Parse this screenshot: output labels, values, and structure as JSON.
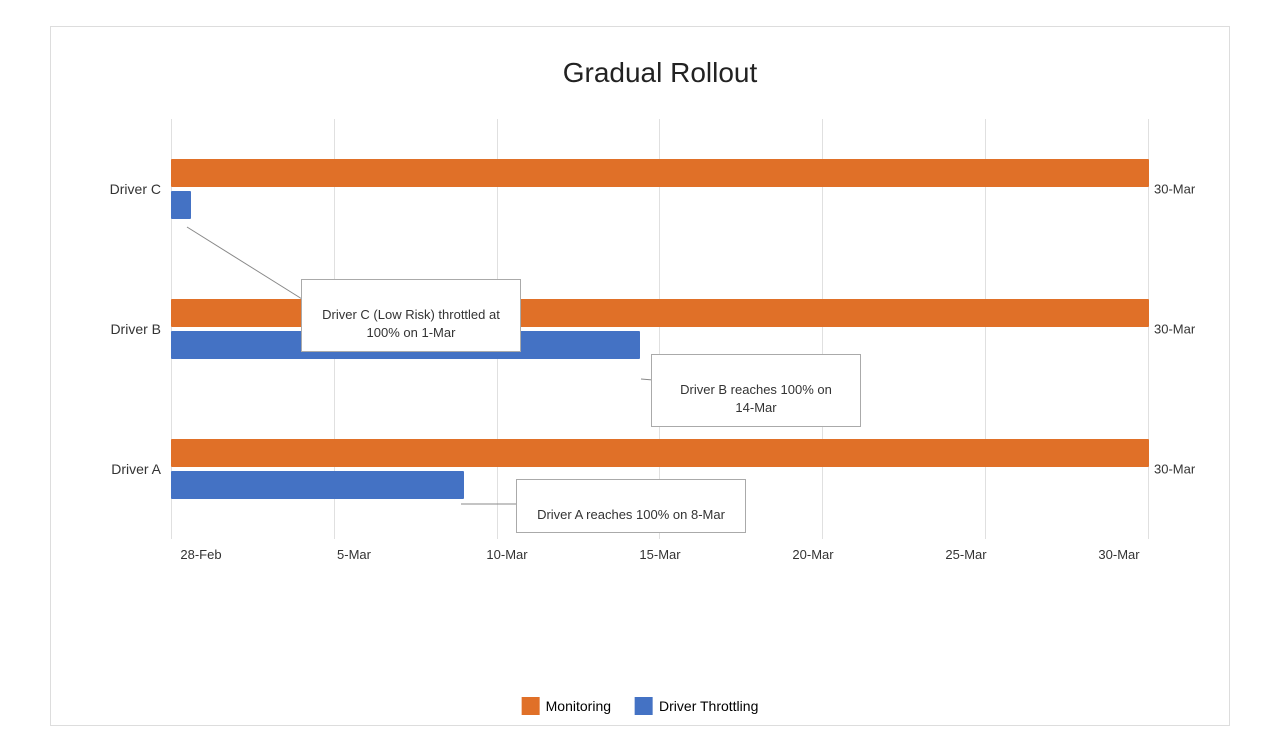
{
  "chart": {
    "title": "Gradual Rollout",
    "yLabels": [
      "Driver C",
      "Driver B",
      "Driver A"
    ],
    "xLabels": [
      "28-Feb",
      "5-Mar",
      "10-Mar",
      "15-Mar",
      "20-Mar",
      "25-Mar",
      "30-Mar"
    ],
    "endLabels": [
      "30-Mar",
      "30-Mar",
      "30-Mar"
    ],
    "legend": {
      "items": [
        {
          "label": "Monitoring",
          "color": "orange"
        },
        {
          "label": "Driver Throttling",
          "color": "blue"
        }
      ]
    },
    "callouts": [
      {
        "id": "callout-c",
        "text": "Driver C (Low Risk) throttled at\n100% on 1-Mar"
      },
      {
        "id": "callout-b",
        "text": "Driver B reaches 100% on\n14-Mar"
      },
      {
        "id": "callout-a",
        "text": "Driver A reaches 100% on 8-Mar"
      }
    ],
    "drivers": [
      {
        "name": "Driver C",
        "orangeWidth": 100,
        "blueWidth": 2
      },
      {
        "name": "Driver B",
        "orangeWidth": 100,
        "blueWidth": 48
      },
      {
        "name": "Driver A",
        "orangeWidth": 100,
        "blueWidth": 30
      }
    ]
  }
}
